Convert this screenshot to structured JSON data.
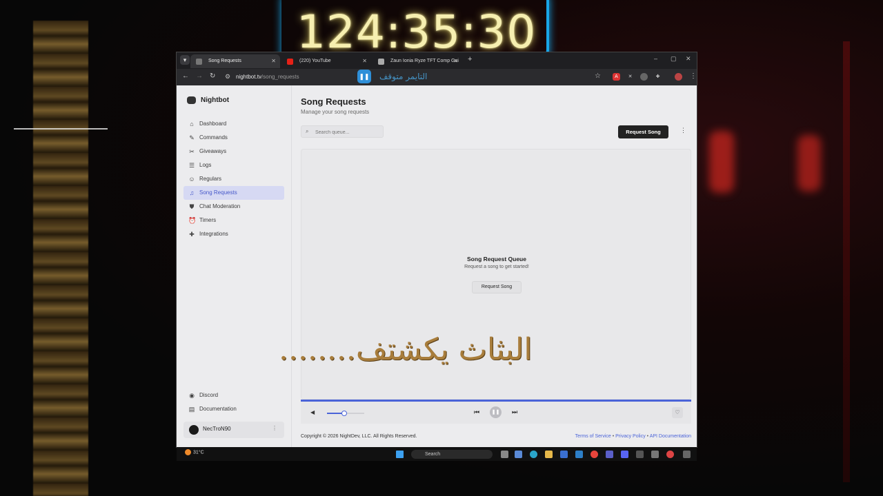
{
  "overlay": {
    "timer": "124:35:30",
    "paused_label": "التايمر متوقف",
    "caption": "البثاث يكشتف........"
  },
  "browser": {
    "tabs": [
      {
        "label": "Song Requests",
        "active": true,
        "favicon_color": "#777777"
      },
      {
        "label": "(220) YouTube",
        "active": false,
        "favicon_color": "#e62117"
      },
      {
        "label": "Zaun Ionia Ryze TFT Comp Gui",
        "active": false,
        "favicon_color": "#aaaaaa"
      }
    ],
    "url_host": "nightbot.tv",
    "url_path": "/song_requests"
  },
  "sidebar": {
    "brand": "Nightbot",
    "items": [
      {
        "label": "Dashboard",
        "icon": "home-icon",
        "glyph": "⌂",
        "active": false
      },
      {
        "label": "Commands",
        "icon": "wand-icon",
        "glyph": "✎",
        "active": false
      },
      {
        "label": "Giveaways",
        "icon": "gift-icon",
        "glyph": "✂",
        "active": false
      },
      {
        "label": "Logs",
        "icon": "list-icon",
        "glyph": "☰",
        "active": false
      },
      {
        "label": "Regulars",
        "icon": "users-icon",
        "glyph": "☺",
        "active": false
      },
      {
        "label": "Song Requests",
        "icon": "headphones-icon",
        "glyph": "♫",
        "active": true
      },
      {
        "label": "Chat Moderation",
        "icon": "shield-icon",
        "glyph": "⛊",
        "active": false
      },
      {
        "label": "Timers",
        "icon": "clock-icon",
        "glyph": "⏰",
        "active": false
      },
      {
        "label": "Integrations",
        "icon": "puzzle-icon",
        "glyph": "✚",
        "active": false
      }
    ],
    "bottom_links": [
      {
        "label": "Discord",
        "icon": "discord-icon",
        "glyph": "◉"
      },
      {
        "label": "Documentation",
        "icon": "book-icon",
        "glyph": "▤"
      }
    ],
    "user": {
      "name": "NecTroN90"
    }
  },
  "main": {
    "title": "Song Requests",
    "subtitle": "Manage your song requests",
    "search_placeholder": "Search queue...",
    "request_button": "Request Song",
    "queue": {
      "title": "Song Request Queue",
      "subtitle": "Request a song to get started!",
      "button": "Request Song"
    },
    "player": {
      "volume": 0.45
    }
  },
  "footer": {
    "copyright": "Copyright © 2026 NightDev, LLC. All Rights Reserved.",
    "links": [
      "Terms of Service",
      "Privacy Policy",
      "API Documentation"
    ]
  },
  "taskbar": {
    "temperature": "31°C",
    "search": "Search"
  },
  "colors": {
    "accent": "#4a63d8",
    "active_bg": "#d6d9f3",
    "timer_glow": "#19a6e8",
    "caption": "#a87d3c"
  }
}
